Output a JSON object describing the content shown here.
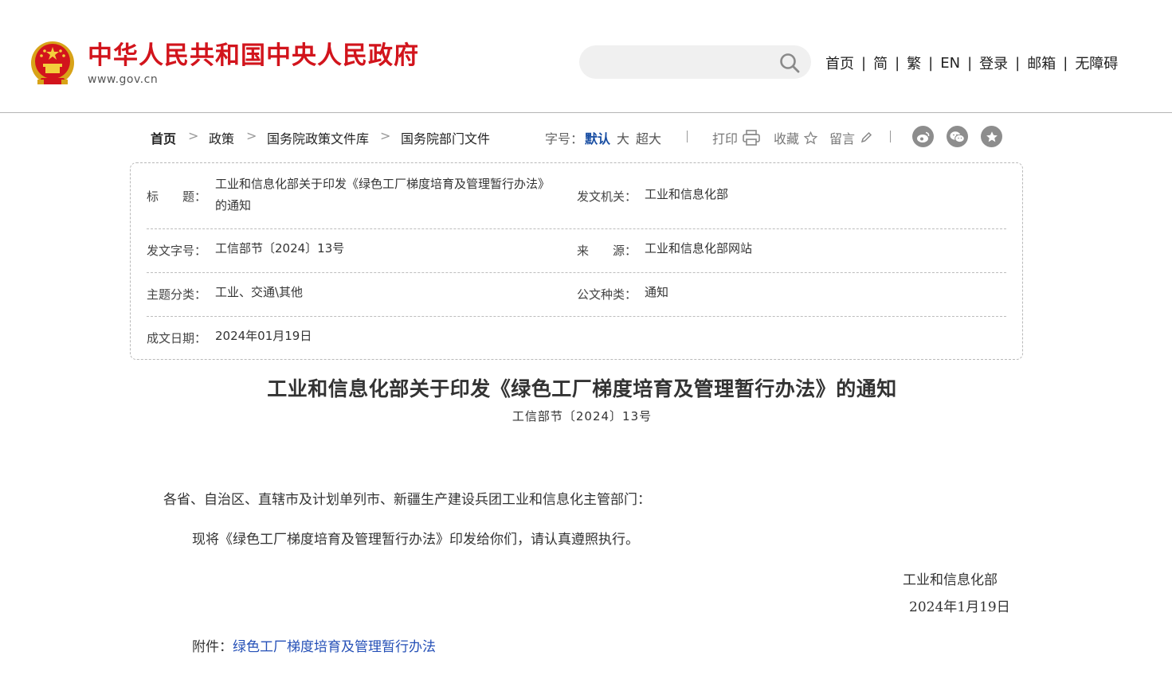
{
  "header": {
    "site_title": "中华人民共和国中央人民政府",
    "site_domain": "www.gov.cn",
    "search_placeholder": "",
    "links": [
      "首页",
      "简",
      "繁",
      "EN",
      "登录",
      "邮箱",
      "无障碍"
    ]
  },
  "breadcrumb": [
    "首页",
    "政策",
    "国务院政策文件库",
    "国务院部门文件"
  ],
  "toolbar": {
    "font_size_label": "字号：",
    "font_default": "默认",
    "font_large": "大",
    "font_xlarge": "超大",
    "print": "打印",
    "favorite": "收藏",
    "comment": "留言"
  },
  "info": {
    "title_label": "标　　题：",
    "title_line1": "工业和信息化部关于印发《绿色工厂梯度培育及管理暂行办法》",
    "title_line2": "的通知",
    "issuer_label": "发文机关：",
    "issuer": "工业和信息化部",
    "doc_no_label": "发文字号：",
    "doc_no": "工信部节〔2024〕13号",
    "source_label": "来　　源：",
    "source": "工业和信息化部网站",
    "category_label": "主题分类：",
    "category": "工业、交通\\其他",
    "doc_type_label": "公文种类：",
    "doc_type": "通知",
    "date_label": "成文日期：",
    "date": "2024年01月19日"
  },
  "document": {
    "title": "工业和信息化部关于印发《绿色工厂梯度培育及管理暂行办法》的通知",
    "number": "工信部节〔2024〕13号",
    "salutation": "各省、自治区、直辖市及计划单列市、新疆生产建设兵团工业和信息化主管部门：",
    "paragraph": "现将《绿色工厂梯度培育及管理暂行办法》印发给你们，请认真遵照执行。",
    "signer": "工业和信息化部",
    "sign_date": "2024年1月19日",
    "attachment_label": "附件：",
    "attachment_link": "绿色工厂梯度培育及管理暂行办法"
  },
  "colors": {
    "brand_red": "#d2141c",
    "link_blue": "#2550b7",
    "active_blue": "#1a4fa3"
  }
}
